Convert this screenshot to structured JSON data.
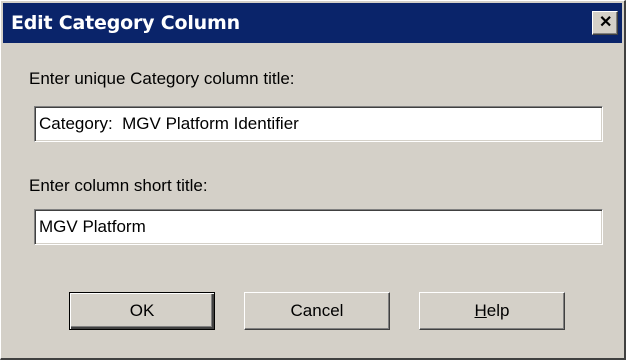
{
  "window": {
    "title": "Edit Category Column",
    "close_glyph": "✕"
  },
  "form": {
    "title_label": "Enter unique Category column title:",
    "title_value": "Category:  MGV Platform Identifier",
    "short_label": "Enter column short title:",
    "short_value": "MGV Platform"
  },
  "buttons": {
    "ok": "OK",
    "cancel": "Cancel",
    "help_accel": "H",
    "help_rest": "elp"
  },
  "colors": {
    "titlebar": "#0a246a",
    "face": "#d4d0c8"
  }
}
